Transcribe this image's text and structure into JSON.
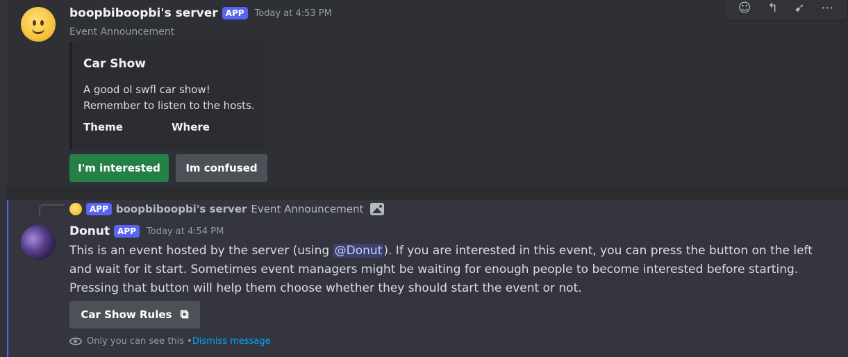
{
  "message1": {
    "username": "boopbiboopbi's server",
    "badge": "APP",
    "timestamp": "Today at 4:53 PM",
    "subtitle": "Event Announcement",
    "embed": {
      "title": "Car Show",
      "description_line1": "A good ol swfl car show!",
      "description_line2": "Remember to listen to the hosts.",
      "field1_name": "Theme",
      "field2_name": "Where"
    },
    "buttons": {
      "interested": "I'm interested",
      "confused": "Im confused"
    }
  },
  "hover_toolbar": {
    "icons": [
      "add-reaction-icon",
      "reply-icon",
      "forward-icon",
      "more-icon"
    ]
  },
  "message2": {
    "reply": {
      "badge": "APP",
      "username": "boopbiboopbi's server",
      "text": "Event Announcement"
    },
    "username": "Donut",
    "badge": "APP",
    "timestamp": "Today at 4:54 PM",
    "content_before_mention": "This is an event hosted by the server (using ",
    "mention": "@Donut",
    "content_after_mention": "). If you are interested in this event, you can press the button on the left and wait for it start. Sometimes event managers might be waiting for enough people to become interested before starting. Pressing that button will help them choose whether they should start the event or not.",
    "link_button": "Car Show Rules",
    "ephemeral_text": "Only you can see this • ",
    "dismiss_label": "Dismiss message"
  },
  "colors": {
    "background": "#313338",
    "brand": "#5865f2",
    "success_button": "#248046",
    "secondary_button": "#4e5058",
    "link": "#00a8fc"
  }
}
